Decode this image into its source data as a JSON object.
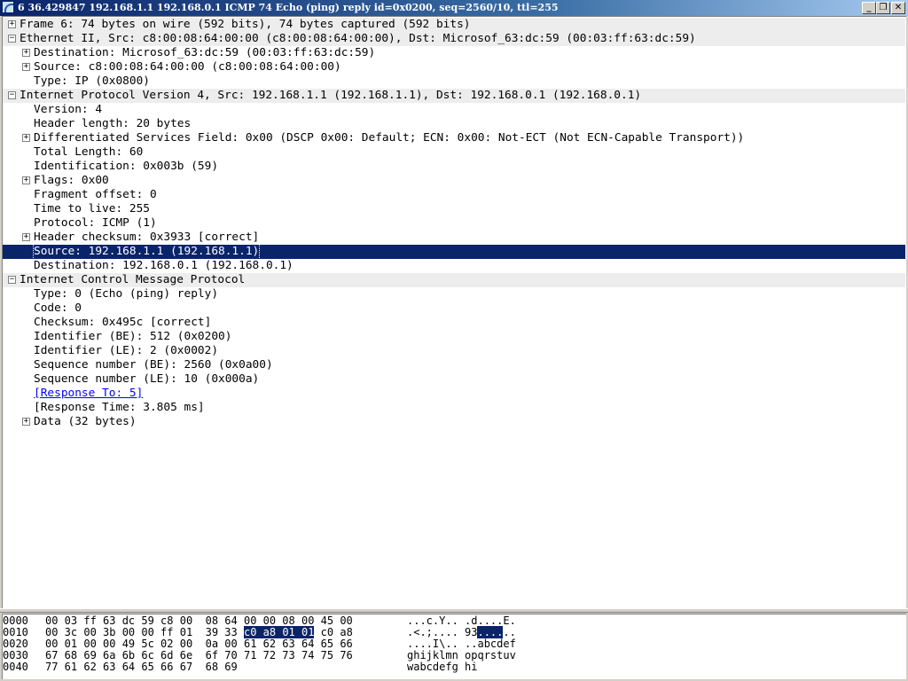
{
  "title_bar": {
    "title": "6 36.429847 192.168.1.1 192.168.0.1 ICMP 74 Echo (ping) reply    id=0x0200, seq=2560/10, ttl=255",
    "min_glyph": "_",
    "max_glyph": "❐",
    "close_glyph": "✕"
  },
  "packet_details": {
    "rows": [
      {
        "text": "Frame 6: 74 bytes on wire (592 bits), 74 bytes captured (592 bits)",
        "expander": "+"
      },
      {
        "text": "Ethernet II, Src: c8:00:08:64:00:00 (c8:00:08:64:00:00), Dst: Microsof_63:dc:59 (00:03:ff:63:dc:59)",
        "expander": "−"
      },
      {
        "text": "Destination: Microsof_63:dc:59 (00:03:ff:63:dc:59)",
        "expander": "+"
      },
      {
        "text": "Source: c8:00:08:64:00:00 (c8:00:08:64:00:00)",
        "expander": "+"
      },
      {
        "text": "Type: IP (0x0800)"
      },
      {
        "text": "Internet Protocol Version 4, Src: 192.168.1.1 (192.168.1.1), Dst: 192.168.0.1 (192.168.0.1)",
        "expander": "−"
      },
      {
        "text": "Version: 4"
      },
      {
        "text": "Header length: 20 bytes"
      },
      {
        "text": "Differentiated Services Field: 0x00 (DSCP 0x00: Default; ECN: 0x00: Not-ECT (Not ECN-Capable Transport))",
        "expander": "+"
      },
      {
        "text": "Total Length: 60"
      },
      {
        "text": "Identification: 0x003b (59)"
      },
      {
        "text": "Flags: 0x00",
        "expander": "+"
      },
      {
        "text": "Fragment offset: 0"
      },
      {
        "text": "Time to live: 255"
      },
      {
        "text": "Protocol: ICMP (1)"
      },
      {
        "text": "Header checksum: 0x3933 [correct]",
        "expander": "+"
      },
      {
        "text": "Source: 192.168.1.1 (192.168.1.1)",
        "selected": true
      },
      {
        "text": "Destination: 192.168.0.1 (192.168.0.1)"
      },
      {
        "text": "Internet Control Message Protocol",
        "expander": "−"
      },
      {
        "text": "Type: 0 (Echo (ping) reply)"
      },
      {
        "text": "Code: 0"
      },
      {
        "text": "Checksum: 0x495c [correct]"
      },
      {
        "text": "Identifier (BE): 512 (0x0200)"
      },
      {
        "text": "Identifier (LE): 2 (0x0002)"
      },
      {
        "text": "Sequence number (BE): 2560 (0x0a00)"
      },
      {
        "text": "Sequence number (LE): 10 (0x000a)"
      },
      {
        "text": "[Response To: 5]",
        "link": true
      },
      {
        "text": "[Response Time: 3.805 ms]"
      },
      {
        "text": "Data (32 bytes)",
        "expander": "+"
      }
    ]
  },
  "hex_dump": {
    "rows": [
      {
        "offset": "0000",
        "pre": "00 03 ff 63 dc 59 c8 00  08 64 00 00 08 00 45 00",
        "hl": "",
        "post": "",
        "ascii_pre": "...c.Y.. .d....E.",
        "ascii_hl": "",
        "ascii_post": ""
      },
      {
        "offset": "0010",
        "pre": "00 3c 00 3b 00 00 ff 01  39 33 ",
        "hl": "c0 a8 01 01",
        "post": " c0 a8",
        "ascii_pre": ".<.;.... 93",
        "ascii_hl": "....",
        "ascii_post": ".."
      },
      {
        "offset": "0020",
        "pre": "00 01 00 00 49 5c 02 00  0a 00 61 62 63 64 65 66",
        "hl": "",
        "post": "",
        "ascii_pre": "....I\\.. ..abcdef",
        "ascii_hl": "",
        "ascii_post": ""
      },
      {
        "offset": "0030",
        "pre": "67 68 69 6a 6b 6c 6d 6e  6f 70 71 72 73 74 75 76",
        "hl": "",
        "post": "",
        "ascii_pre": "ghijklmn opqrstuv",
        "ascii_hl": "",
        "ascii_post": ""
      },
      {
        "offset": "0040",
        "pre": "77 61 62 63 64 65 66 67  68 69",
        "hl": "",
        "post": "",
        "ascii_pre": "wabcdefg hi",
        "ascii_hl": "",
        "ascii_post": ""
      }
    ]
  }
}
